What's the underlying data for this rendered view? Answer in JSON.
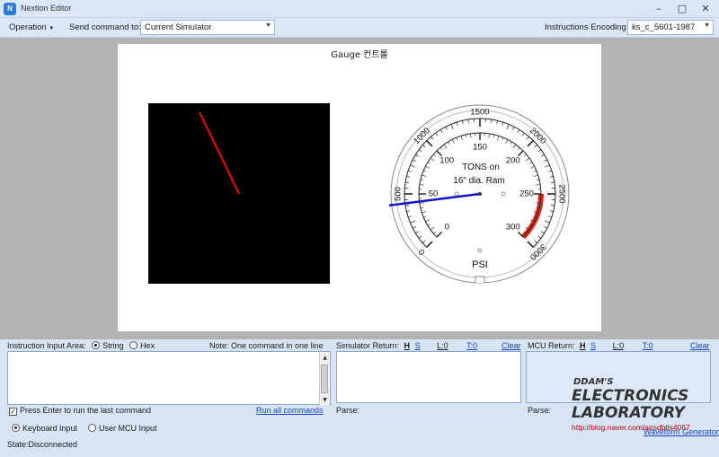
{
  "window": {
    "app_icon": "N",
    "title": "Nextion Editor",
    "minimize": "–",
    "maximize": "□",
    "close": "✕"
  },
  "toolbar": {
    "operation_label": "Operation",
    "send_command_label": "Send command to:",
    "send_command_value": "Current Simulator",
    "encoding_label": "Instructions Encoding:",
    "encoding_value": "ks_c_5601-1987"
  },
  "page": {
    "title": "Gauge 컨트롤",
    "gauge": {
      "outer_scale_labels": [
        "0",
        "500",
        "1000",
        "1500",
        "2000",
        "2500",
        "3000"
      ],
      "inner_scale_labels": [
        "0",
        "50",
        "100",
        "150",
        "200",
        "250",
        "300"
      ],
      "center_text_line1": "TONS on",
      "center_text_line2": "16\" dia. Ram",
      "unit": "PSI",
      "needle_outer_value": 420,
      "redline_start_outer_value": 2500
    }
  },
  "instruction": {
    "label": "Instruction Input Area:",
    "string_label": "String",
    "hex_label": "Hex",
    "note": "Note: One command in one line",
    "press_enter_label": "Press Enter to run the last command",
    "run_all_label": "Run all commands",
    "keyboard_input_label": "Keyboard Input",
    "user_mcu_input_label": "User MCU Input"
  },
  "simulator_return": {
    "label": "Simulator Return:",
    "h": "H",
    "s": "S",
    "l": "L:0",
    "t": "T:0",
    "clear": "Clear",
    "parse": "Parse:"
  },
  "mcu_return": {
    "label": "MCU Return:",
    "h": "H",
    "s": "S",
    "l": "L:0",
    "t": "T:0",
    "clear": "Clear",
    "parse": "Parse:",
    "waveform_link": "Waveform Generator"
  },
  "watermark": {
    "line1": "DDAM'S",
    "line2": "ELECTRONICS",
    "line3": "LABORATORY",
    "url": "http://blog.naver.com/ansdbtls4067"
  },
  "status": {
    "text": "State:Disconnected"
  },
  "colors": {
    "needle_blue": "#1010d0",
    "red_line": "#ff0000",
    "redline_band": "#e02a1a"
  }
}
